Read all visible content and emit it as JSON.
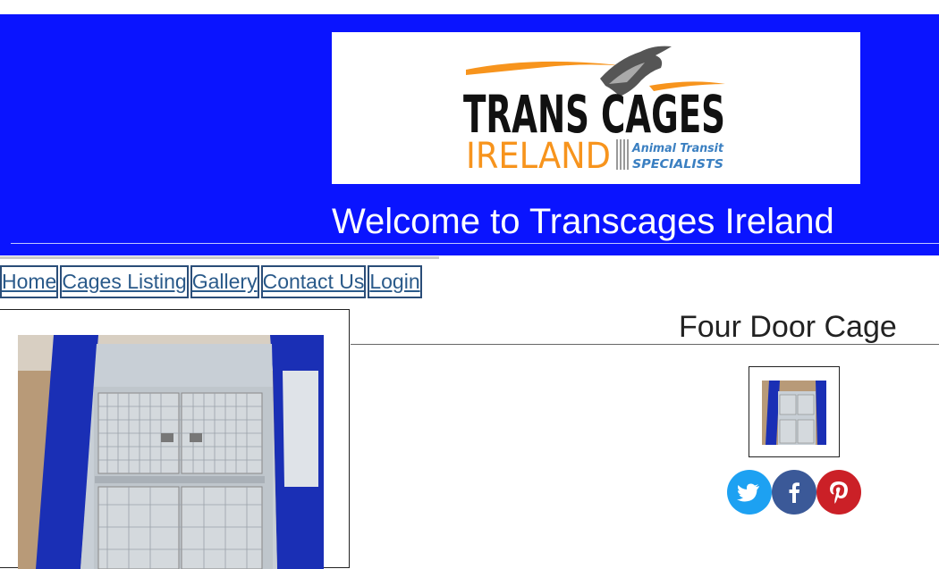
{
  "header": {
    "logo": {
      "line1": "TRANS CAGES",
      "line2": "IRELAND",
      "tagline1": "Animal Transit",
      "tagline2": "SPECIALISTS"
    },
    "welcome": "Welcome to Transcages Ireland",
    "background_color": "#0a14ff"
  },
  "nav": {
    "items": [
      {
        "label": "Home"
      },
      {
        "label": "Cages Listing"
      },
      {
        "label": "Gallery"
      },
      {
        "label": "Contact Us"
      },
      {
        "label": "Login"
      }
    ],
    "link_color": "#2a5a8a"
  },
  "product": {
    "title": "Four Door Cage",
    "main_image": "van-rear-cage-photo",
    "thumbnail": "van-rear-cage-thumbnail"
  },
  "share": {
    "icons": [
      "twitter-icon",
      "facebook-icon",
      "pinterest-icon"
    ],
    "colors": {
      "twitter": "#1da1f2",
      "facebook": "#3b5998",
      "pinterest": "#cb2027"
    }
  }
}
